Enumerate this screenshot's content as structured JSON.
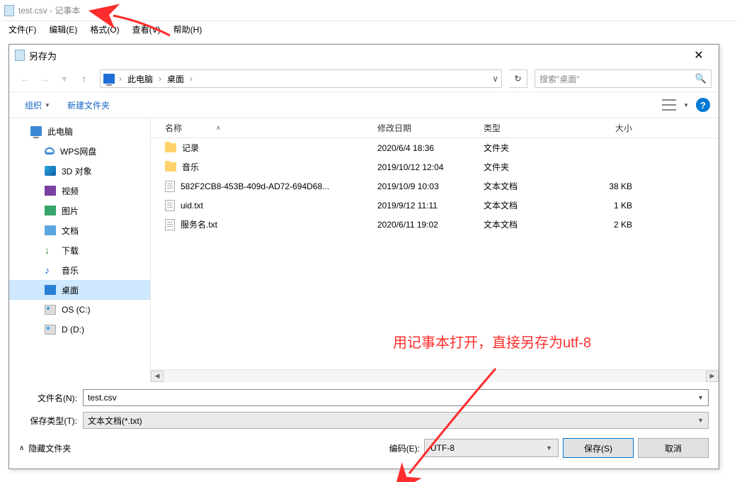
{
  "notepad": {
    "title": "test.csv - 记事本",
    "menu": {
      "file": "文件(F)",
      "edit": "编辑(E)",
      "format": "格式(O)",
      "view": "查看(V)",
      "help": "帮助(H)"
    }
  },
  "dialog": {
    "title": "另存为",
    "breadcrumb": {
      "root": "此电脑",
      "folder": "桌面"
    },
    "search_placeholder": "搜索\"桌面\"",
    "toolbar": {
      "organize": "组织",
      "new_folder": "新建文件夹"
    },
    "sidebar": {
      "items": [
        {
          "label": "此电脑",
          "icon": "pc",
          "indent": false
        },
        {
          "label": "WPS网盘",
          "icon": "wps",
          "indent": true
        },
        {
          "label": "3D 对象",
          "icon": "3d",
          "indent": true
        },
        {
          "label": "视频",
          "icon": "video",
          "indent": true
        },
        {
          "label": "图片",
          "icon": "pic",
          "indent": true
        },
        {
          "label": "文档",
          "icon": "doc",
          "indent": true
        },
        {
          "label": "下载",
          "icon": "dl",
          "indent": true
        },
        {
          "label": "音乐",
          "icon": "music",
          "indent": true
        },
        {
          "label": "桌面",
          "icon": "desk",
          "indent": true,
          "selected": true
        },
        {
          "label": "OS (C:)",
          "icon": "disk",
          "indent": true
        },
        {
          "label": "D (D:)",
          "icon": "disk",
          "indent": true
        }
      ]
    },
    "columns": {
      "name": "名称",
      "date": "修改日期",
      "type": "类型",
      "size": "大小"
    },
    "files": [
      {
        "name": "记录",
        "date": "2020/6/4 18:36",
        "type": "文件夹",
        "size": "",
        "icon": "folder"
      },
      {
        "name": "音乐",
        "date": "2019/10/12 12:04",
        "type": "文件夹",
        "size": "",
        "icon": "folder"
      },
      {
        "name": "582F2CB8-453B-409d-AD72-694D68...",
        "date": "2019/10/9 10:03",
        "type": "文本文档",
        "size": "38 KB",
        "icon": "txt"
      },
      {
        "name": "uid.txt",
        "date": "2019/9/12 11:11",
        "type": "文本文档",
        "size": "1 KB",
        "icon": "txt"
      },
      {
        "name": "服务名.txt",
        "date": "2020/6/11 19:02",
        "type": "文本文档",
        "size": "2 KB",
        "icon": "txt"
      }
    ],
    "filename_label": "文件名(N):",
    "filename_value": "test.csv",
    "filetype_label": "保存类型(T):",
    "filetype_value": "文本文档(*.txt)",
    "hide_folders": "隐藏文件夹",
    "encoding_label": "编码(E):",
    "encoding_value": "UTF-8",
    "save_button": "保存(S)",
    "cancel_button": "取消"
  },
  "annotation": {
    "text": "用记事本打开，直接另存为utf-8"
  }
}
